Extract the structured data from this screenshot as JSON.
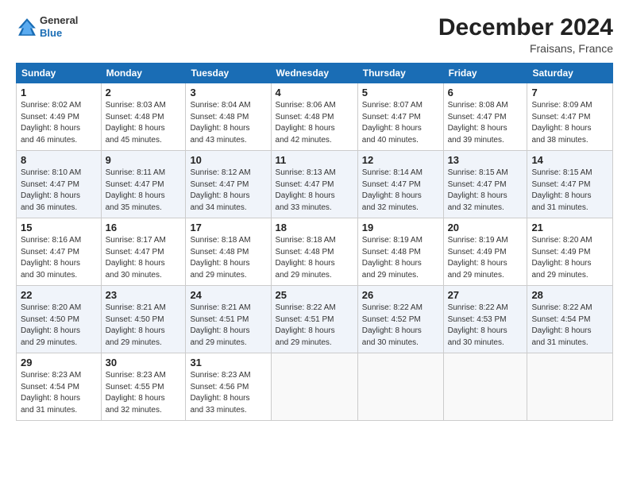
{
  "header": {
    "logo": {
      "general": "General",
      "blue": "Blue"
    },
    "title": "December 2024",
    "location": "Fraisans, France"
  },
  "days_of_week": [
    "Sunday",
    "Monday",
    "Tuesday",
    "Wednesday",
    "Thursday",
    "Friday",
    "Saturday"
  ],
  "weeks": [
    [
      {
        "day": "1",
        "sunrise": "8:02 AM",
        "sunset": "4:49 PM",
        "daylight": "8 hours and 46 minutes."
      },
      {
        "day": "2",
        "sunrise": "8:03 AM",
        "sunset": "4:48 PM",
        "daylight": "8 hours and 45 minutes."
      },
      {
        "day": "3",
        "sunrise": "8:04 AM",
        "sunset": "4:48 PM",
        "daylight": "8 hours and 43 minutes."
      },
      {
        "day": "4",
        "sunrise": "8:06 AM",
        "sunset": "4:48 PM",
        "daylight": "8 hours and 42 minutes."
      },
      {
        "day": "5",
        "sunrise": "8:07 AM",
        "sunset": "4:47 PM",
        "daylight": "8 hours and 40 minutes."
      },
      {
        "day": "6",
        "sunrise": "8:08 AM",
        "sunset": "4:47 PM",
        "daylight": "8 hours and 39 minutes."
      },
      {
        "day": "7",
        "sunrise": "8:09 AM",
        "sunset": "4:47 PM",
        "daylight": "8 hours and 38 minutes."
      }
    ],
    [
      {
        "day": "8",
        "sunrise": "8:10 AM",
        "sunset": "4:47 PM",
        "daylight": "8 hours and 36 minutes."
      },
      {
        "day": "9",
        "sunrise": "8:11 AM",
        "sunset": "4:47 PM",
        "daylight": "8 hours and 35 minutes."
      },
      {
        "day": "10",
        "sunrise": "8:12 AM",
        "sunset": "4:47 PM",
        "daylight": "8 hours and 34 minutes."
      },
      {
        "day": "11",
        "sunrise": "8:13 AM",
        "sunset": "4:47 PM",
        "daylight": "8 hours and 33 minutes."
      },
      {
        "day": "12",
        "sunrise": "8:14 AM",
        "sunset": "4:47 PM",
        "daylight": "8 hours and 32 minutes."
      },
      {
        "day": "13",
        "sunrise": "8:15 AM",
        "sunset": "4:47 PM",
        "daylight": "8 hours and 32 minutes."
      },
      {
        "day": "14",
        "sunrise": "8:15 AM",
        "sunset": "4:47 PM",
        "daylight": "8 hours and 31 minutes."
      }
    ],
    [
      {
        "day": "15",
        "sunrise": "8:16 AM",
        "sunset": "4:47 PM",
        "daylight": "8 hours and 30 minutes."
      },
      {
        "day": "16",
        "sunrise": "8:17 AM",
        "sunset": "4:47 PM",
        "daylight": "8 hours and 30 minutes."
      },
      {
        "day": "17",
        "sunrise": "8:18 AM",
        "sunset": "4:48 PM",
        "daylight": "8 hours and 29 minutes."
      },
      {
        "day": "18",
        "sunrise": "8:18 AM",
        "sunset": "4:48 PM",
        "daylight": "8 hours and 29 minutes."
      },
      {
        "day": "19",
        "sunrise": "8:19 AM",
        "sunset": "4:48 PM",
        "daylight": "8 hours and 29 minutes."
      },
      {
        "day": "20",
        "sunrise": "8:19 AM",
        "sunset": "4:49 PM",
        "daylight": "8 hours and 29 minutes."
      },
      {
        "day": "21",
        "sunrise": "8:20 AM",
        "sunset": "4:49 PM",
        "daylight": "8 hours and 29 minutes."
      }
    ],
    [
      {
        "day": "22",
        "sunrise": "8:20 AM",
        "sunset": "4:50 PM",
        "daylight": "8 hours and 29 minutes."
      },
      {
        "day": "23",
        "sunrise": "8:21 AM",
        "sunset": "4:50 PM",
        "daylight": "8 hours and 29 minutes."
      },
      {
        "day": "24",
        "sunrise": "8:21 AM",
        "sunset": "4:51 PM",
        "daylight": "8 hours and 29 minutes."
      },
      {
        "day": "25",
        "sunrise": "8:22 AM",
        "sunset": "4:51 PM",
        "daylight": "8 hours and 29 minutes."
      },
      {
        "day": "26",
        "sunrise": "8:22 AM",
        "sunset": "4:52 PM",
        "daylight": "8 hours and 30 minutes."
      },
      {
        "day": "27",
        "sunrise": "8:22 AM",
        "sunset": "4:53 PM",
        "daylight": "8 hours and 30 minutes."
      },
      {
        "day": "28",
        "sunrise": "8:22 AM",
        "sunset": "4:54 PM",
        "daylight": "8 hours and 31 minutes."
      }
    ],
    [
      {
        "day": "29",
        "sunrise": "8:23 AM",
        "sunset": "4:54 PM",
        "daylight": "8 hours and 31 minutes."
      },
      {
        "day": "30",
        "sunrise": "8:23 AM",
        "sunset": "4:55 PM",
        "daylight": "8 hours and 32 minutes."
      },
      {
        "day": "31",
        "sunrise": "8:23 AM",
        "sunset": "4:56 PM",
        "daylight": "8 hours and 33 minutes."
      },
      null,
      null,
      null,
      null
    ]
  ],
  "labels": {
    "sunrise": "Sunrise:",
    "sunset": "Sunset:",
    "daylight": "Daylight:"
  }
}
